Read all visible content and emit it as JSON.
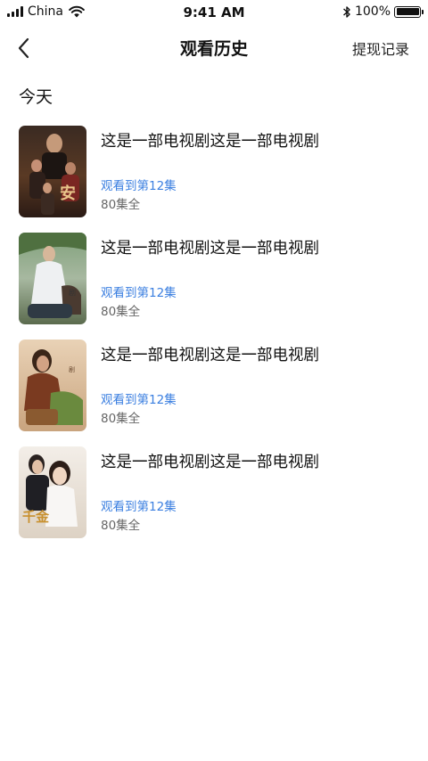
{
  "status_bar": {
    "carrier": "China",
    "time": "9:41 AM",
    "battery": "100%"
  },
  "nav": {
    "title": "观看历史",
    "action": "提现记录"
  },
  "section": {
    "title": "今天"
  },
  "items": [
    {
      "title": "这是一部电视剧这是一部电视剧",
      "progress": "观看到第12集",
      "total": "80集全"
    },
    {
      "title": "这是一部电视剧这是一部电视剧",
      "progress": "观看到第12集",
      "total": "80集全"
    },
    {
      "title": "这是一部电视剧这是一部电视剧",
      "progress": "观看到第12集",
      "total": "80集全"
    },
    {
      "title": "这是一部电视剧这是一部电视剧",
      "progress": "观看到第12集",
      "total": "80集全"
    }
  ]
}
